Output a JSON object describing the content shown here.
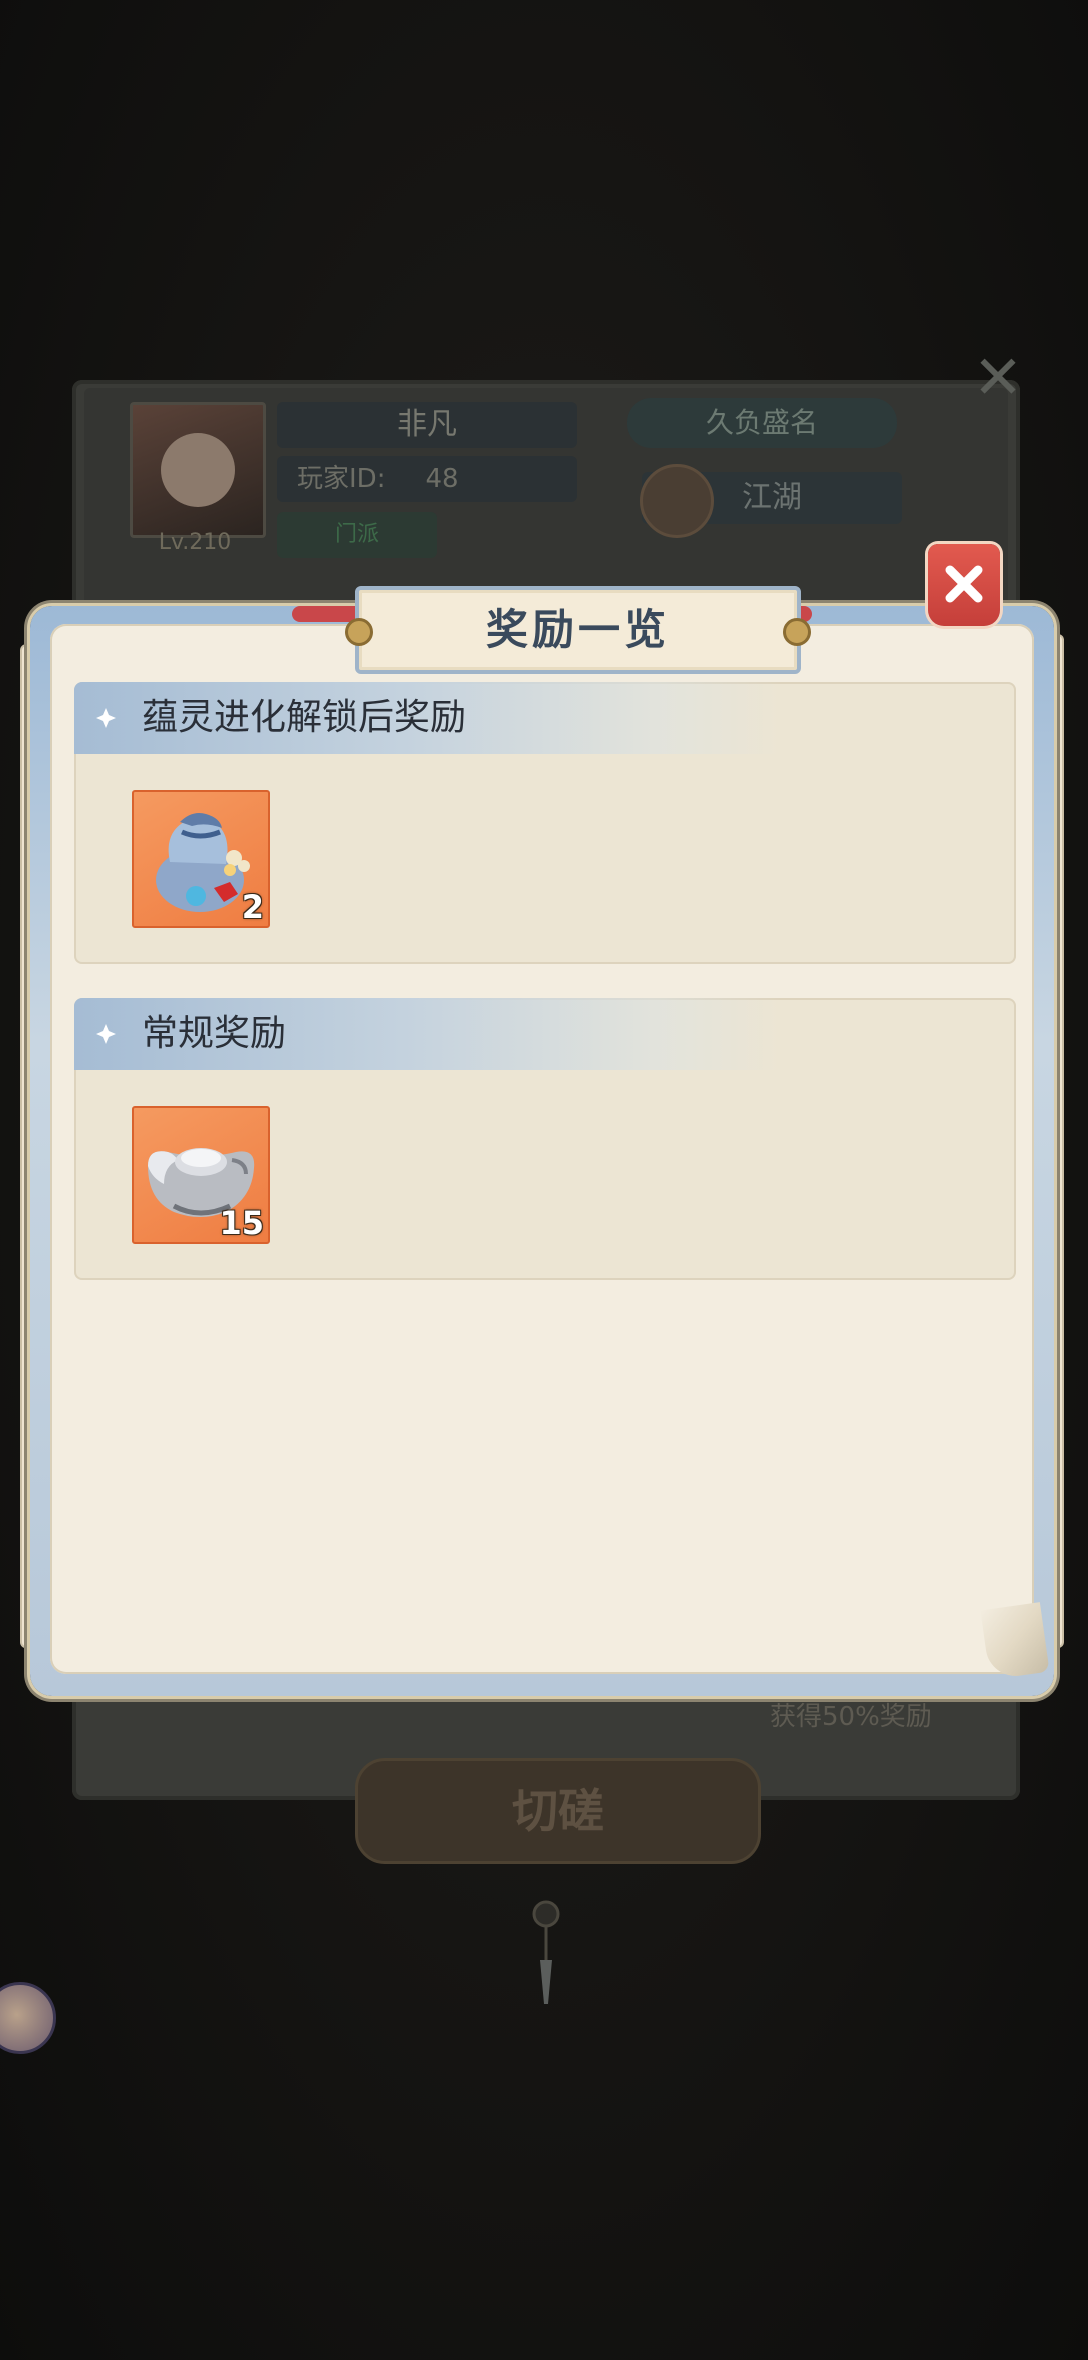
{
  "background_panel": {
    "player_name": "非凡",
    "player_id_label": "玩家ID:",
    "player_id_value": "48",
    "level": "Lv.210",
    "green_label": "门派",
    "title_badge": "久负盛名",
    "sect": "江湖",
    "reward_note": "获得50%奖励",
    "action_button": "切磋"
  },
  "dialog": {
    "title": "奖励一览",
    "sections": [
      {
        "title": "蕴灵进化解锁后奖励",
        "items": [
          {
            "icon": "pouch-icon",
            "count": "2"
          }
        ]
      },
      {
        "title": "常规奖励",
        "items": [
          {
            "icon": "silver-ingot-icon",
            "count": "15"
          }
        ]
      }
    ]
  },
  "colors": {
    "close_button": "#d94c45",
    "item_background": "#ef7d42",
    "section_header": "#a5bcd4",
    "paper": "#f3ede0"
  }
}
